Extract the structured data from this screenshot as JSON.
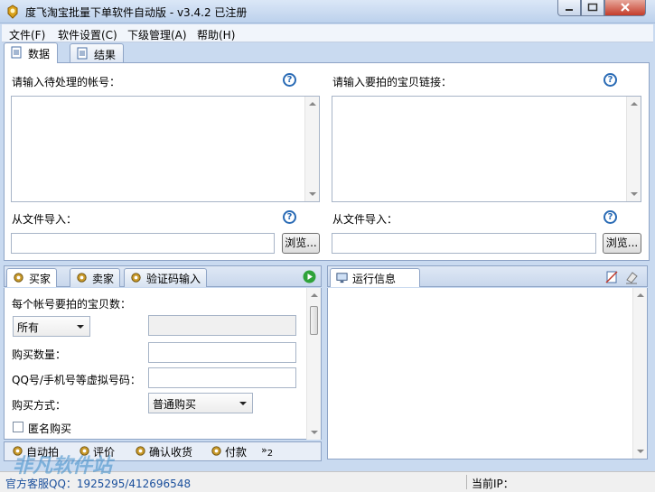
{
  "window": {
    "title": "度飞淘宝批量下单软件自动版 - v3.4.2 已注册"
  },
  "menu": [
    "文件(F)",
    "软件设置(C)",
    "下级管理(A)",
    "帮助(H)"
  ],
  "top_tabs": [
    "数据",
    "结果"
  ],
  "data_panel": {
    "accounts_label": "请输入待处理的帐号：",
    "links_label": "请输入要拍的宝贝链接：",
    "import_label_left": "从文件导入：",
    "import_label_right": "从文件导入：",
    "browse_label": "浏览..."
  },
  "buyer_tabs": [
    "买家",
    "卖家",
    "验证码输入"
  ],
  "buyer_panel": {
    "items_per_account_label": "每个帐号要拍的宝贝数：",
    "items_select": "所有",
    "quantity_label": "购买数量：",
    "qq_label": "QQ号/手机号等虚拟号码：",
    "method_label": "购买方式：",
    "method_select": "普通购买",
    "anonymous_label": "匿名购买"
  },
  "bottom_tabs": [
    "自动拍",
    "评价",
    "确认收货",
    "付款"
  ],
  "bottom_tabs_more": "2",
  "run_panel": {
    "title": "运行信息"
  },
  "status": {
    "support": "官方客服QQ：1925295/412696548",
    "ip_label": "当前IP："
  },
  "watermark": "非凡软件站"
}
